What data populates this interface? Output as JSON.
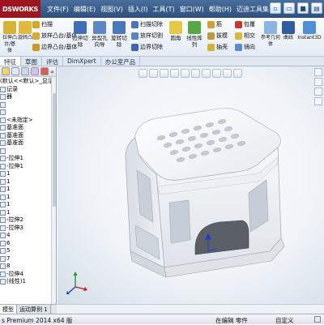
{
  "app": {
    "logo": "DSWORKS",
    "menus": [
      "文件(F)",
      "编辑(E)",
      "视图(V)",
      "插入(I)",
      "工具(T)",
      "窗口(W)",
      "帮助(H)",
      "迈迪工具集"
    ]
  },
  "commands": {
    "extrude_boss": "拉伸凸台/基体",
    "revolve_boss": "旋转凸台/基体",
    "sweep": "扫描",
    "loft": "放样凸台/基体",
    "boundary": "边界凸台/基体",
    "extrude_cut": "拉伸切除",
    "hole_wizard": "异型孔向导",
    "revolve_cut": "旋转切除",
    "swept_cut": "扫描切除",
    "lofted_cut": "放样切割",
    "boundary_cut": "边界切除",
    "fillet": "圆角",
    "linear_pattern": "线性阵列",
    "rib": "筋",
    "draft": "拔模",
    "shell": "抽壳",
    "wrap": "包覆",
    "intersect": "相交",
    "mirror": "镜向",
    "ref_geometry": "参考几何体",
    "curves": "曲线",
    "instant3d": "Instant3D"
  },
  "tabs": [
    "特征",
    "草图",
    "评估",
    "DimXpert",
    "办公室产品"
  ],
  "tree": [
    "(默认<<默认>_显示状态",
    "记录",
    "器",
    "",
    "",
    "<未指定>",
    "基准面",
    "基准面",
    "基准面",
    "",
    "-拉伸1",
    "-拉伸1",
    "1",
    "1",
    "1",
    "1",
    "1",
    "1",
    "-拉伸2",
    "-拉伸3",
    "4",
    "6",
    "5",
    "7",
    "8",
    "-拉伸4",
    "(线性)1"
  ],
  "bottom_tabs": [
    "模型",
    "运动算例 1"
  ],
  "status": {
    "version": "s Premium 2014 x64 版",
    "mode": "在编辑 零件",
    "custom": "自定义"
  }
}
